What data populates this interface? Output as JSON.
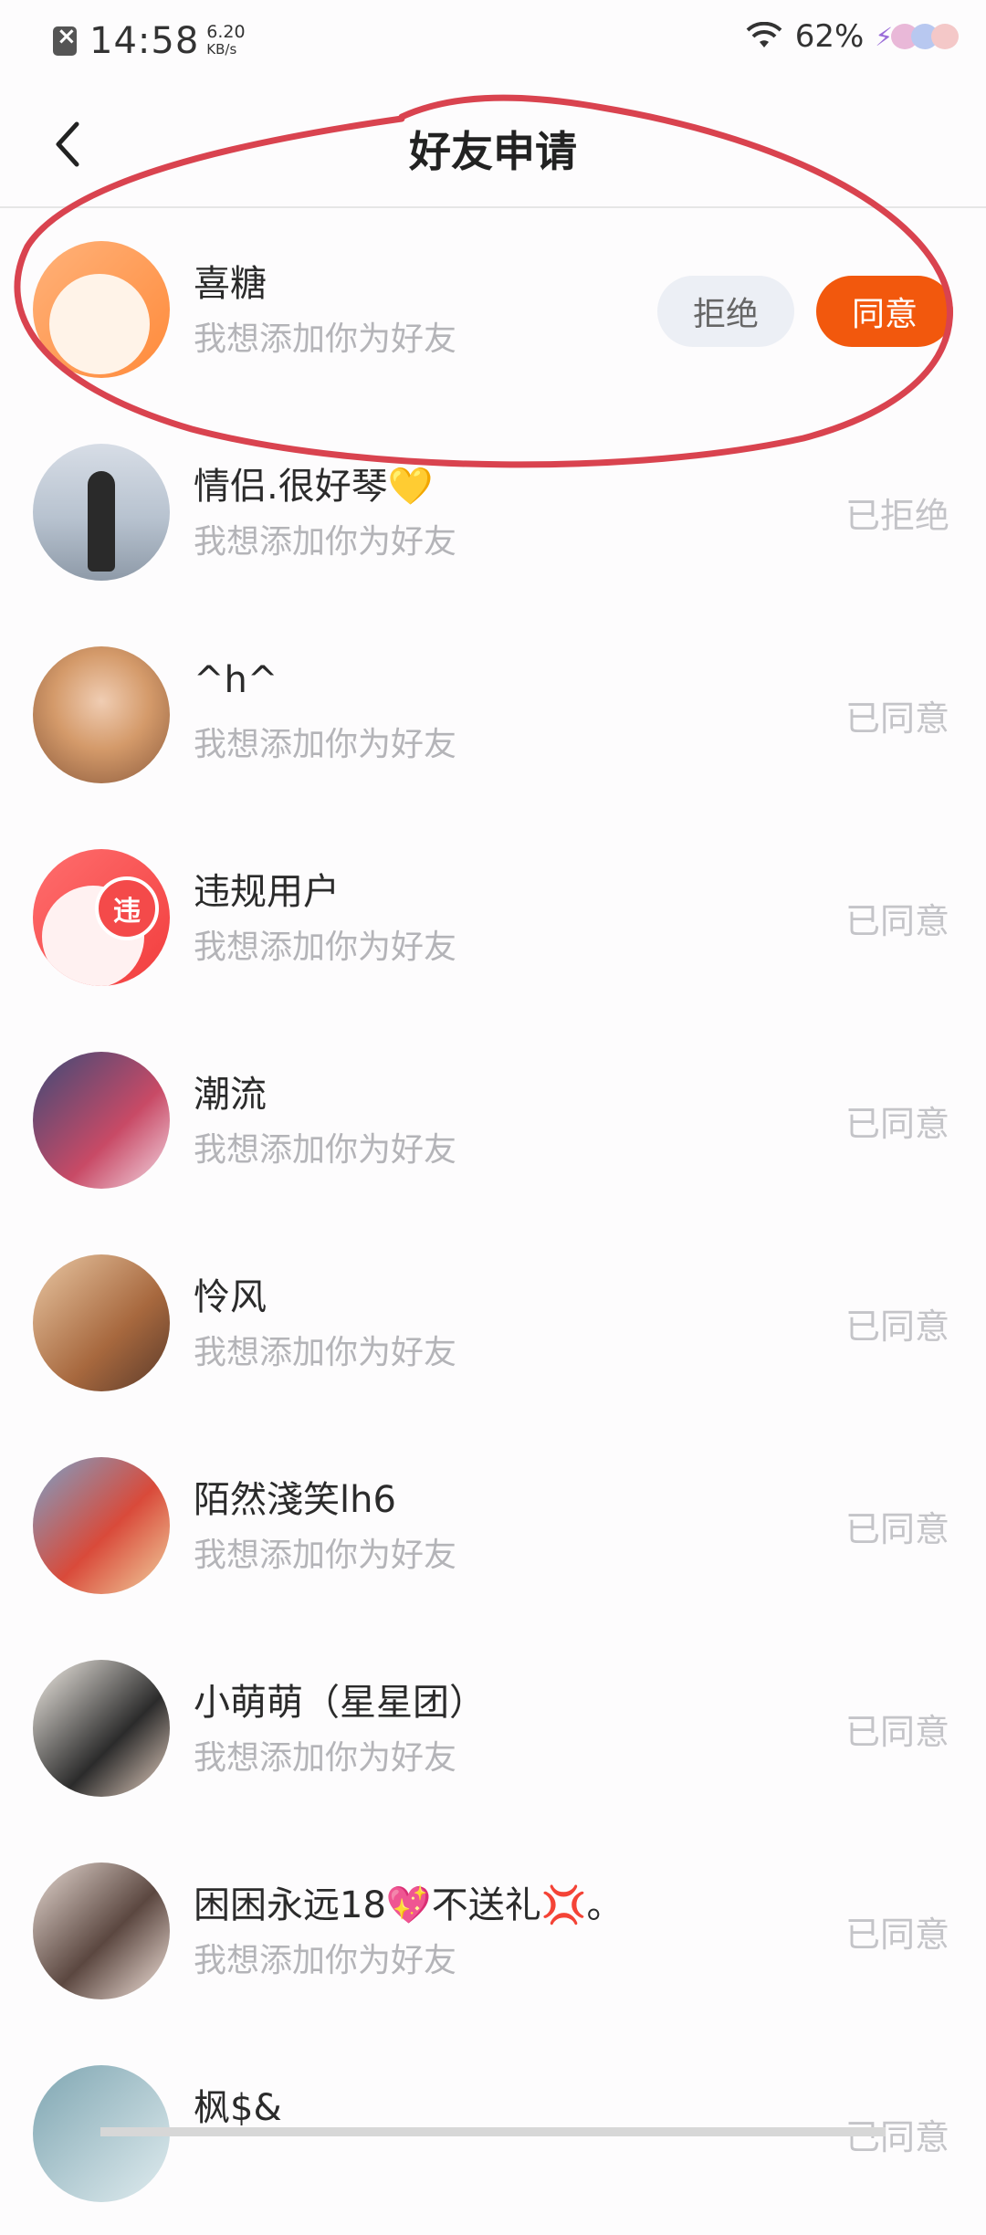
{
  "status_bar": {
    "time": "14:58",
    "net_speed_value": "6.20",
    "net_speed_unit": "KB/s",
    "battery": "62%"
  },
  "header": {
    "title": "好友申请",
    "back_icon": "chevron-left-icon"
  },
  "requests": [
    {
      "name": "喜糖",
      "message": "我想添加你为好友",
      "reject_label": "拒绝",
      "agree_label": "同意"
    },
    {
      "name": "情侣.很好琴💛",
      "message": "我想添加你为好友",
      "status": "已拒绝"
    },
    {
      "name": "^h^",
      "message": "我想添加你为好友",
      "status": "已同意"
    },
    {
      "name": "违规用户",
      "message": "我想添加你为好友",
      "status": "已同意",
      "badge": "违"
    },
    {
      "name": "潮流",
      "message": "我想添加你为好友",
      "status": "已同意"
    },
    {
      "name": "怜风",
      "message": "我想添加你为好友",
      "status": "已同意"
    },
    {
      "name": "陌然淺笑lh6",
      "message": "我想添加你为好友",
      "status": "已同意"
    },
    {
      "name": "小萌萌（星星团）",
      "message": "我想添加你为好友",
      "status": "已同意"
    },
    {
      "name": "困困永远18💖不送礼💢。",
      "message": "我想添加你为好友",
      "status": "已同意"
    },
    {
      "name": "枫$&",
      "message": "",
      "status": "已同意"
    }
  ],
  "colors": {
    "accent": "#f2580d",
    "annotation": "#d9434f",
    "muted_text": "#b4b4b8"
  }
}
